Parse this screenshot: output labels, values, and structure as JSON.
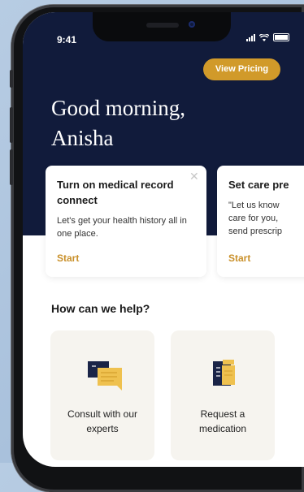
{
  "status_bar": {
    "time": "9:41"
  },
  "header": {
    "pricing_button": "View Pricing",
    "greeting_line1": "Good morning,",
    "greeting_line2": "Anisha"
  },
  "cards": [
    {
      "title": "Turn on medical record connect",
      "body": "Let's get your health history all in one place.",
      "action": "Start"
    },
    {
      "title": "Set care pre",
      "body": "\"Let us know care for you, send prescrip",
      "action": "Start"
    }
  ],
  "help": {
    "heading": "How can we help?",
    "tiles": [
      {
        "label": "Consult with our experts",
        "icon": "chat-bubbles-icon"
      },
      {
        "label": "Request a medication",
        "icon": "medication-icon"
      }
    ]
  },
  "colors": {
    "hero_background": "#111b3b",
    "accent": "#d19a2a",
    "tile_background": "#f6f4ef"
  }
}
